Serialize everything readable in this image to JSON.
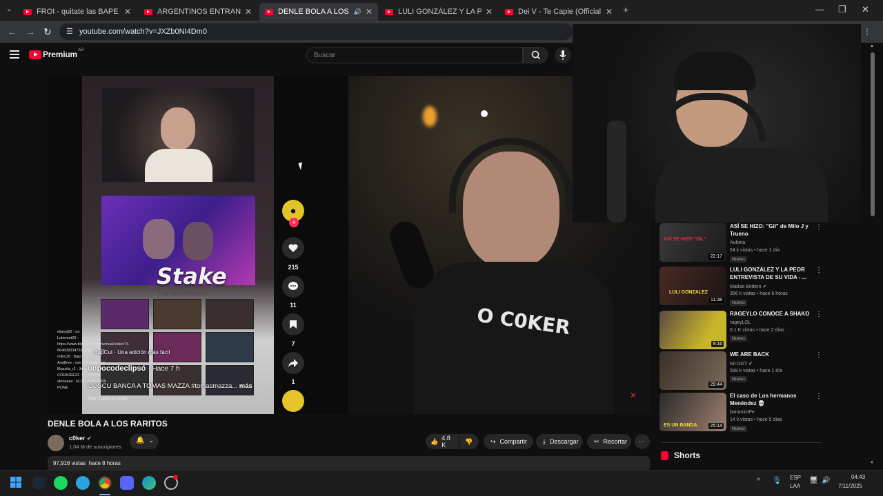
{
  "browser": {
    "tabs": [
      {
        "title": "FROI - quitate las BAPE (Visuali",
        "active": false,
        "audio": false
      },
      {
        "title": "ARGENTINOS ENTRAN EN LLAM",
        "active": false,
        "audio": false
      },
      {
        "title": "DENLE BOLA A LOS RARITO",
        "active": true,
        "audio": true
      },
      {
        "title": "LULI GONZÁLEZ Y LA PEOR EN",
        "active": false,
        "audio": false
      },
      {
        "title": "Dei V - Te Capie (Official Video)",
        "active": false,
        "audio": false
      }
    ],
    "url": "youtube.com/watch?v=JXZb0NI4Dm0"
  },
  "masthead": {
    "logo_text": "Premium",
    "country_code": "AR",
    "search_placeholder": "Buscar"
  },
  "player": {
    "tiktok": {
      "brand": "Stake",
      "brand_tag": "USE RESPONSIBLY",
      "capcut_label": "CapCut · Una edición más fácil",
      "author": "unpocodeclipsó",
      "posted": "· Hace 7 h",
      "caption": "COSCU BANCA A TOMAS MAZZA #tomasmazza...",
      "more": "más",
      "translate": "Ver traducción",
      "likes": "215",
      "comments": "11",
      "saves": "7",
      "shares": "1",
      "chat_lines": [
        "elianxj62 : no",
        "Lukemat03 :",
        "https://www.tiktok.com/@memuel/video/75",
        "6646083347614298110?_t=.. ",
        "milnc20 : Bajo",
        "AvaBree : vox xox under xxx",
        "Mazzila_r1 : Ja xx",
        "CORAJEE22 : Es DOWN",
        "aloneeee : ELOC A ADOPPA",
        "PONE"
      ]
    },
    "cam_shirt_text": "O C0KER"
  },
  "video": {
    "title": "DENLE BOLA A LOS RARITOS",
    "channel": "c0ker",
    "subscribers": "1.04 M de suscriptores",
    "likes": "4.8 K",
    "share_label": "Compartir",
    "download_label": "Descargar",
    "clip_label": "Recortar",
    "views": "97,916 vistas",
    "published": "hace 8 horas"
  },
  "recommendations": [
    {
      "title": "ASÍ SE HIZO: \"Gil\" de Milo J y Trueno",
      "channel": "Auforia",
      "verified": false,
      "meta": "64 k vistas • hace 1 día",
      "badge": "Nuevo",
      "duration": "22:17",
      "thumb_text": "ASÍ SE HIZO \"GIL\""
    },
    {
      "title": "LULI GONZÁLEZ Y LA PEOR ENTREVISTA DE SU VIDA - ...",
      "channel": "Matías Bottero",
      "verified": true,
      "meta": "356 k vistas • hace 6 horas",
      "badge": "Nuevo",
      "duration": "11:38",
      "thumb_text": "LULI GONZALEZ"
    },
    {
      "title": "RAGEYLO CONOCE A SHAKO",
      "channel": "rageyLOL",
      "verified": false,
      "meta": "6.1 K vistas • hace 2 días",
      "badge": "Nuevo",
      "duration": "9:16",
      "thumb_text": ""
    },
    {
      "title": "WE ARE BACK",
      "channel": "Nil OGT",
      "verified": true,
      "meta": "589 k vistas • hace 1 día",
      "badge": "Nuevo",
      "duration": "29:44",
      "thumb_text": ""
    },
    {
      "title": "El caso de Los hermanos Menéndez 💀",
      "channel": "bananiroPe",
      "verified": false,
      "meta": "14 k vistas • hace 5 días",
      "badge": "Nuevo",
      "duration": "25:14",
      "thumb_text": "ES UN BANDA"
    }
  ],
  "shorts_label": "Shorts",
  "taskbar": {
    "lang": "ESP",
    "layout": "LAA",
    "time": "04:43",
    "date": "7/11/2025"
  },
  "colors": {
    "brand_red": "#ff0033",
    "background": "#0f0f0f",
    "surface": "#272727"
  }
}
